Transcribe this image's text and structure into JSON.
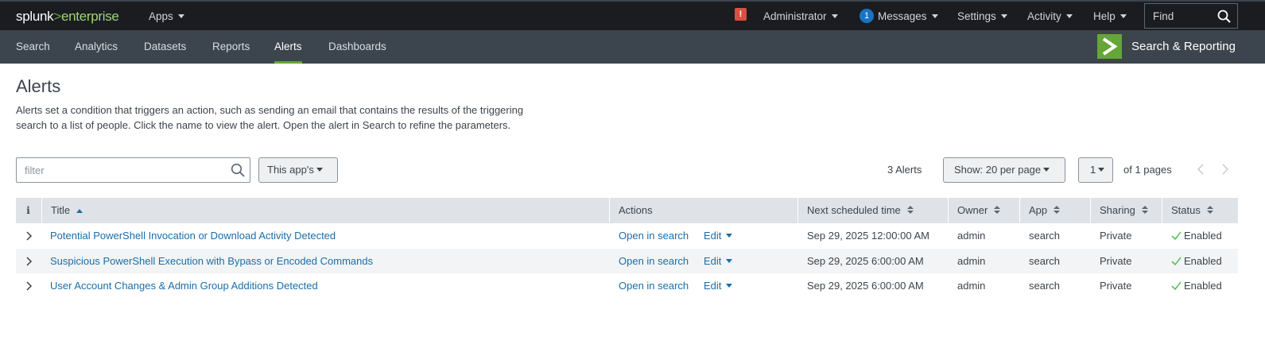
{
  "topbar": {
    "logo_main": "splunk",
    "logo_sep": ">",
    "logo_sub": "enterprise",
    "apps_label": "Apps",
    "alert_badge": "!",
    "admin_label": "Administrator",
    "messages_count": "1",
    "messages_label": "Messages",
    "settings_label": "Settings",
    "activity_label": "Activity",
    "help_label": "Help",
    "find_placeholder": "Find"
  },
  "appbar": {
    "tabs": [
      {
        "label": "Search"
      },
      {
        "label": "Analytics"
      },
      {
        "label": "Datasets"
      },
      {
        "label": "Reports"
      },
      {
        "label": "Alerts",
        "active": true
      },
      {
        "label": "Dashboards"
      }
    ],
    "app_name": "Search & Reporting"
  },
  "page": {
    "title": "Alerts",
    "description_line1": "Alerts set a condition that triggers an action, such as sending an email that contains the results of the triggering",
    "description_line2": "search to a list of people. Click the name to view the alert. Open the alert in Search to refine the parameters."
  },
  "toolbar": {
    "filter_placeholder": "filter",
    "app_filter_label": "This app's",
    "alert_count": "3 Alerts",
    "per_page_label": "Show: 20 per page",
    "page_select": "1",
    "of_pages": "of 1 pages",
    "prev_icon": "chevron-left-icon",
    "next_icon": "chevron-right-icon"
  },
  "table": {
    "columns": {
      "info": "i",
      "title": "Title",
      "actions": "Actions",
      "next_time": "Next scheduled time",
      "owner": "Owner",
      "app": "App",
      "sharing": "Sharing",
      "status": "Status"
    },
    "rows": [
      {
        "title": "Potential PowerShell Invocation or Download Activity Detected",
        "open_label": "Open in search",
        "edit_label": "Edit",
        "next_time": "Sep 29, 2025 12:00:00 AM",
        "owner": "admin",
        "app": "search",
        "sharing": "Private",
        "status": "Enabled"
      },
      {
        "title": "Suspicious PowerShell Execution with Bypass or Encoded Commands",
        "open_label": "Open in search",
        "edit_label": "Edit",
        "next_time": "Sep 29, 2025 6:00:00 AM",
        "owner": "admin",
        "app": "search",
        "sharing": "Private",
        "status": "Enabled"
      },
      {
        "title": "User Account Changes & Admin Group Additions Detected",
        "open_label": "Open in search",
        "edit_label": "Edit",
        "next_time": "Sep 29, 2025 6:00:00 AM",
        "owner": "admin",
        "app": "search",
        "sharing": "Private",
        "status": "Enabled"
      }
    ]
  },
  "colors": {
    "topbar_bg": "#1a1c20",
    "appbar_bg": "#3c444d",
    "accent_green": "#65a637",
    "link_blue": "#1a6ea8",
    "alert_red": "#dc4e41",
    "badge_blue": "#1a73c2",
    "enabled_green": "#5cc05c"
  }
}
